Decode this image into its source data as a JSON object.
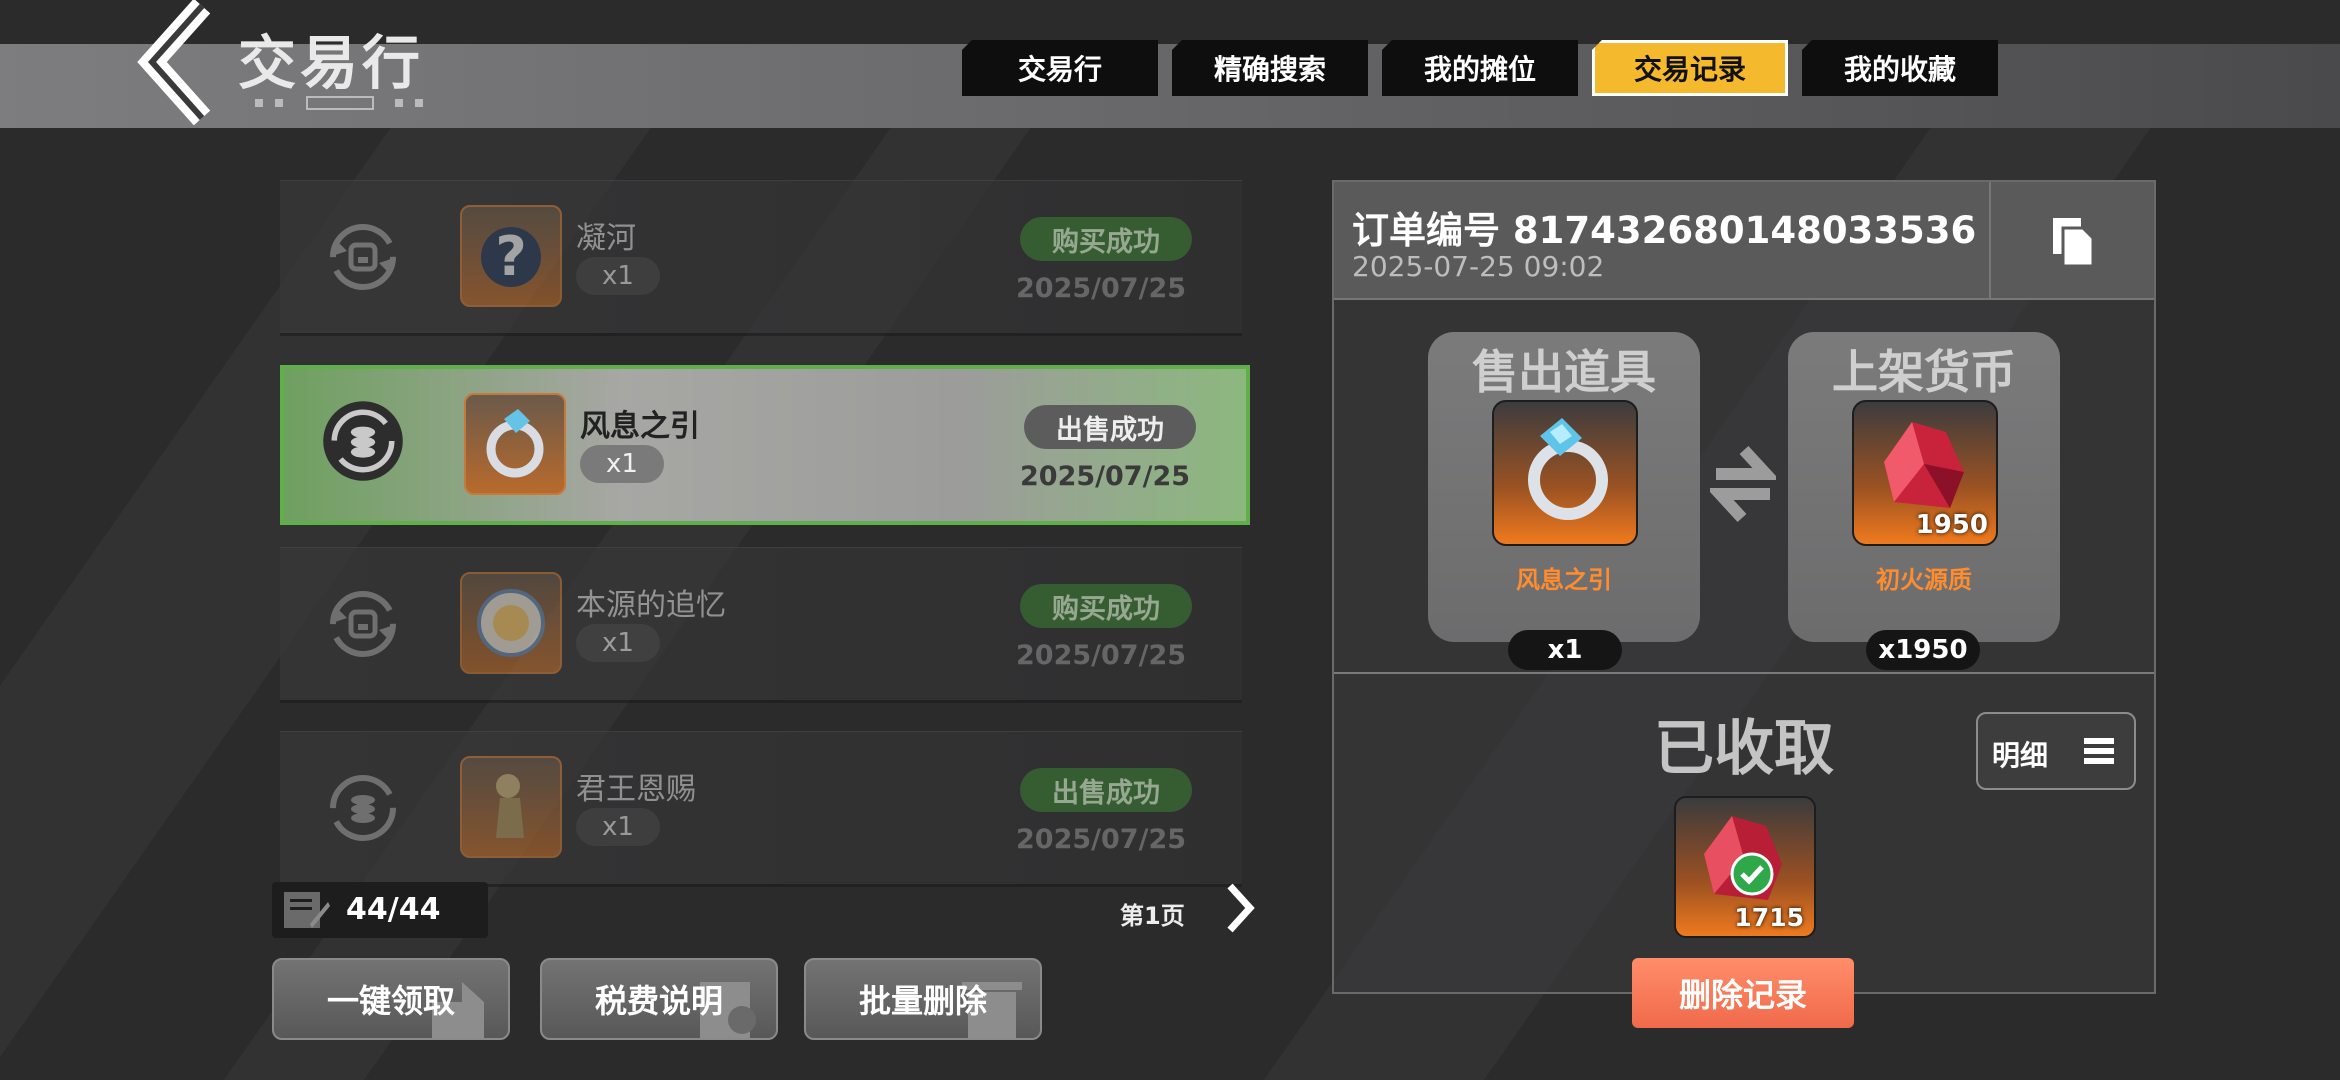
{
  "header": {
    "title": "交易行",
    "tabs": [
      {
        "label": "交易行",
        "active": false
      },
      {
        "label": "精确搜索",
        "active": false
      },
      {
        "label": "我的摊位",
        "active": false
      },
      {
        "label": "交易记录",
        "active": true
      },
      {
        "label": "我的收藏",
        "active": false
      }
    ]
  },
  "records": [
    {
      "name": "凝河",
      "qty": "x1",
      "status": "购买成功",
      "status_type": "buy",
      "date": "2025/07/25",
      "selected": false
    },
    {
      "name": "风息之引",
      "qty": "x1",
      "status": "出售成功",
      "status_type": "sell",
      "date": "2025/07/25",
      "selected": true
    },
    {
      "name": "本源的追忆",
      "qty": "x1",
      "status": "购买成功",
      "status_type": "buy",
      "date": "2025/07/25",
      "selected": false
    },
    {
      "name": "君王恩赐",
      "qty": "x1",
      "status": "出售成功",
      "status_type": "sell",
      "date": "2025/07/25",
      "selected": false
    }
  ],
  "pager": {
    "count": "44/44",
    "page_label": "第1页"
  },
  "buttons": {
    "claim_all": "一键领取",
    "tax_info": "税费说明",
    "batch_delete": "批量删除"
  },
  "detail": {
    "order_label": "订单编号 817432680148033536",
    "order_time": "2025-07-25 09:02",
    "sold_item": {
      "title": "售出道具",
      "name": "风息之引",
      "qty": "x1"
    },
    "listed_currency": {
      "title": "上架货币",
      "name": "初火源质",
      "thumb_count": "1950",
      "qty": "x1950"
    },
    "collected_label": "已收取",
    "detail_button": "明细",
    "reward_count": "1715",
    "delete_button": "删除记录"
  },
  "colors": {
    "accent_tab": "#f5b92e",
    "buy_badge": "#3e7a36",
    "selected_border": "#5fb04a",
    "delete_button": "#f06a4a",
    "currency_name": "#ff8c2e"
  }
}
